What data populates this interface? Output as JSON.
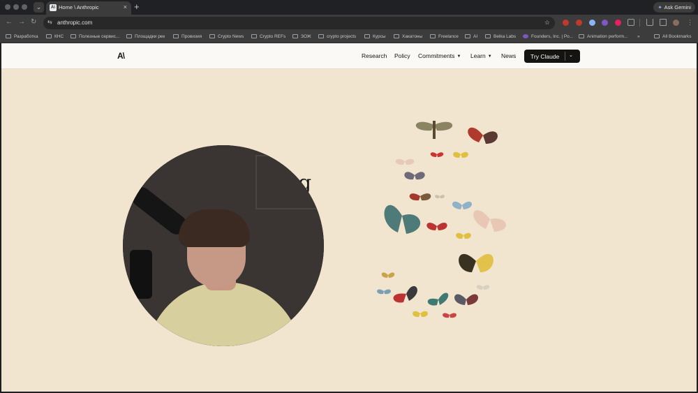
{
  "browser": {
    "tab_title": "Home \\ Anthropic",
    "tab_close": "×",
    "new_tab": "+",
    "tab_search": "⌄",
    "ask_gemini": "Ask Gemini",
    "url": "anthropic.com",
    "nav": {
      "back": "←",
      "forward": "→",
      "reload": "↻"
    },
    "site_info": "⇆",
    "bookmark_star": "☆",
    "bookmarks": [
      "Разработка",
      "КНС",
      "Полезные сервис...",
      "Площадки рек",
      "Провизия",
      "Crypto News",
      "Crypto REFs",
      "ЗОЖ",
      "crypto projects",
      "Курсы",
      "Хакатоны",
      "Freelance",
      "AI",
      "Belka Labs",
      "Founders, Inc. | Po...",
      "Animation perform...",
      "»",
      "All Bookmarks"
    ],
    "extension_colors": [
      "#c0392b",
      "#c0392b",
      "#8ab4f8",
      "#7e57c2",
      "#e91e63"
    ]
  },
  "site": {
    "logo_text": "A\\",
    "nav": {
      "research": "Research",
      "policy": "Policy",
      "commitments": "Commitments",
      "learn": "Learn",
      "news": "News"
    },
    "cta": {
      "label": "Try Claude",
      "chevron": "⌄"
    },
    "colors": {
      "page_bg": "#faf9f5",
      "hero_bg": "#f1e5cf",
      "ink": "#141413"
    }
  },
  "hero": {
    "heading_fragment": "g"
  }
}
